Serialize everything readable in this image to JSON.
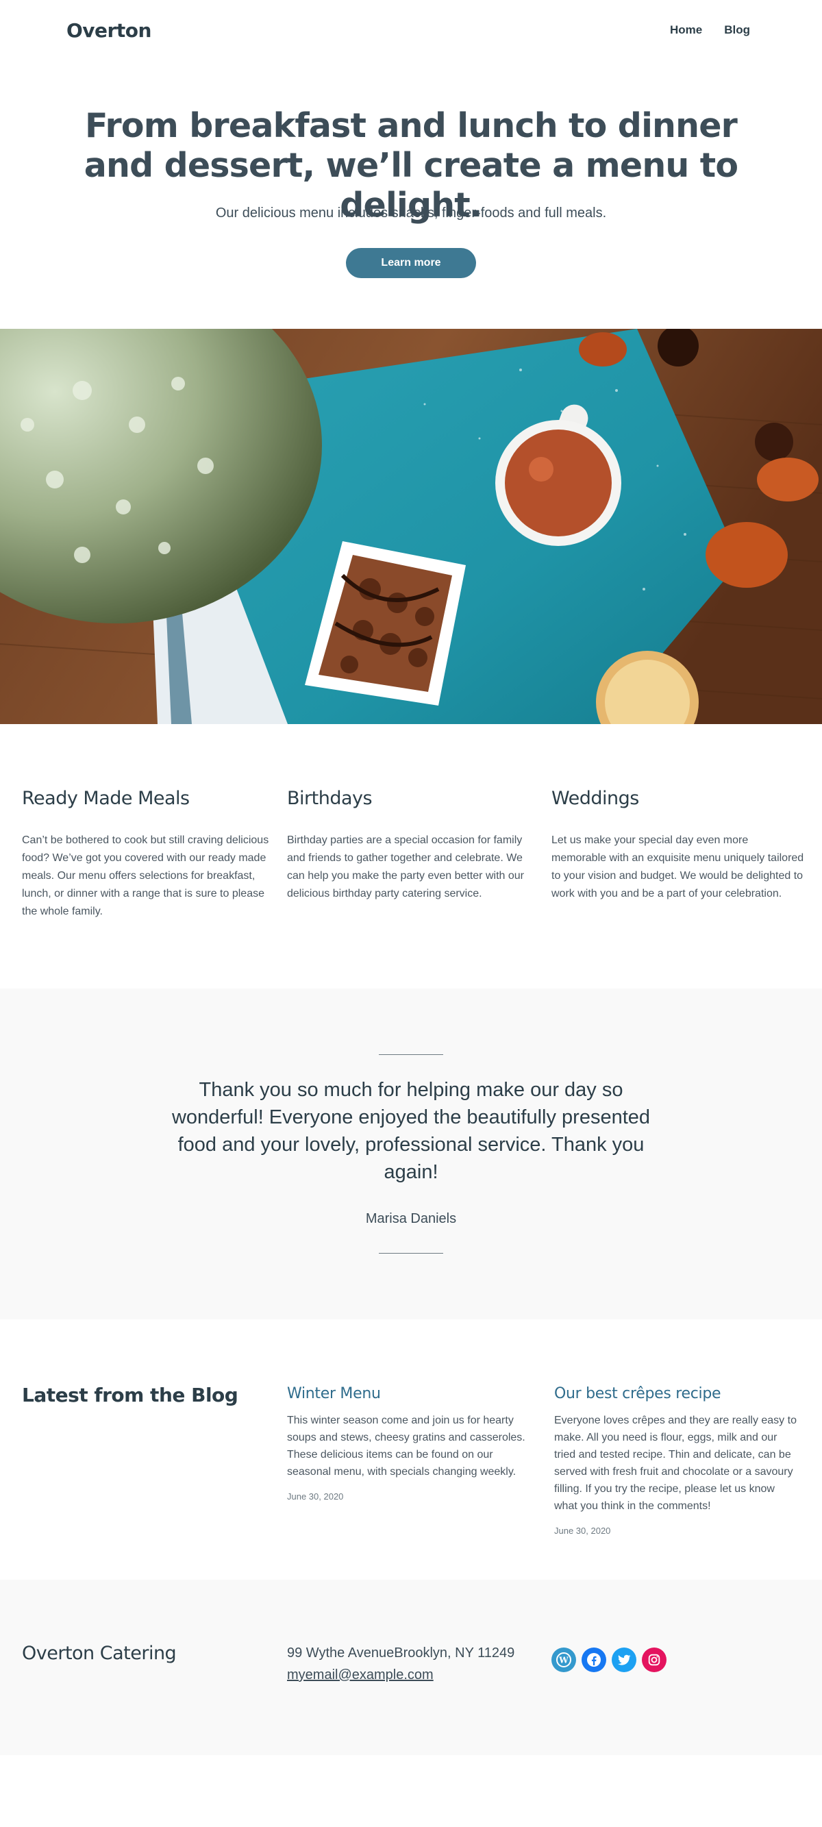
{
  "header": {
    "site_title": "Overton",
    "nav": [
      {
        "label": "Home"
      },
      {
        "label": "Blog"
      }
    ]
  },
  "hero": {
    "title": "From breakfast and lunch to dinner and dessert, we’ll create a menu to delight.",
    "subtitle": "Our delicious menu includes snacks, finger-foods and full meals.",
    "button_label": "Learn more"
  },
  "services": [
    {
      "title": "Ready Made Meals",
      "text": "Can’t be bothered to cook but still craving delicious food? We’ve got you covered with our ready made meals. Our menu offers selections for breakfast, lunch, or dinner with a range that is sure to please the whole family."
    },
    {
      "title": "Birthdays",
      "text": "Birthday parties are a special occasion for family and friends to gather together and celebrate. We can help you make the party even better with our delicious birthday party catering service."
    },
    {
      "title": "Weddings",
      "text": "Let us make your special day even more memorable with an exquisite menu uniquely tailored to your vision and budget. We would be delighted to work with you and be a part of your celebration."
    }
  ],
  "testimonial": {
    "quote": "Thank you so much for helping make our day so wonderful! Everyone enjoyed the beautifully presented food and your lovely, professional service. Thank you again!",
    "author": "Marisa Daniels"
  },
  "blog": {
    "heading": "Latest from the Blog",
    "posts": [
      {
        "title": "Winter Menu",
        "excerpt": "This winter season come and join us for hearty soups and stews, cheesy gratins and casseroles. These delicious items can be found on our seasonal menu, with specials changing weekly.",
        "date": "June 30, 2020"
      },
      {
        "title": "Our best crêpes recipe",
        "excerpt": "Everyone loves crêpes and they are really easy to make. All you need is flour, eggs, milk and our tried and tested recipe. Thin and delicate, can be served with fresh fruit and chocolate or a savoury filling. If you try the recipe, please let us know what you think in the comments!",
        "date": "June 30, 2020"
      }
    ]
  },
  "footer": {
    "title": "Overton Catering",
    "address": "99 Wythe AvenueBrooklyn, NY 11249",
    "email": "myemail@example.com",
    "socials": [
      {
        "icon": "wordpress-icon",
        "color": "#3499cd"
      },
      {
        "icon": "facebook-icon",
        "color": "#1778f2"
      },
      {
        "icon": "twitter-icon",
        "color": "#1da1f2"
      },
      {
        "icon": "instagram-icon",
        "color": "#e4145f"
      }
    ]
  },
  "colors": {
    "accent": "#3e7993",
    "link": "#2f6c8c",
    "text": "#2c3e48",
    "muted_bg": "#f9f9f9"
  }
}
